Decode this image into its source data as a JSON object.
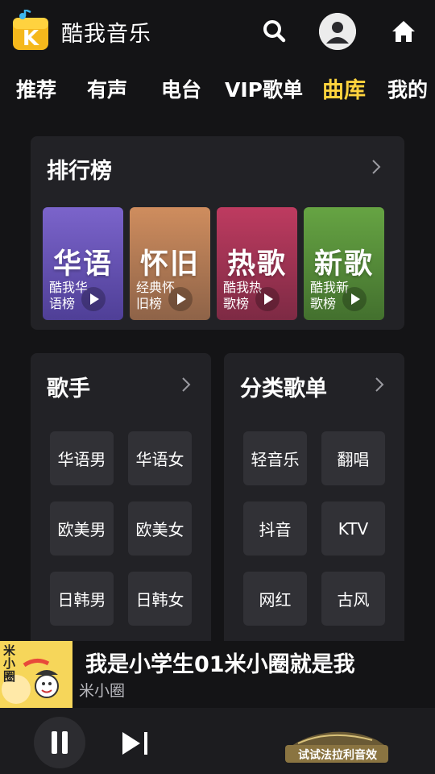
{
  "app": {
    "title": "酷我音乐"
  },
  "nav": {
    "tabs": [
      {
        "label": "推荐"
      },
      {
        "label": "有声"
      },
      {
        "label": "电台"
      },
      {
        "label": "VIP歌单"
      },
      {
        "label": "曲库",
        "active": true
      },
      {
        "label": "我的"
      }
    ]
  },
  "rankings": {
    "title": "排行榜",
    "tiles": [
      {
        "big": "华语",
        "sub": "酷我华语榜",
        "color_top": "#7a63c9",
        "color_bottom": "#5b4aa6"
      },
      {
        "big": "怀旧",
        "sub": "经典怀旧榜",
        "color_top": "#c6875a",
        "color_bottom": "#9e6c4b"
      },
      {
        "big": "热歌",
        "sub": "酷我热歌榜",
        "color_top": "#b3385a",
        "color_bottom": "#8d2f4c"
      },
      {
        "big": "新歌",
        "sub": "酷我新歌榜",
        "color_top": "#5f9a3f",
        "color_bottom": "#4a7a33"
      }
    ]
  },
  "singers": {
    "title": "歌手",
    "chips": [
      "华语男",
      "华语女",
      "欧美男",
      "欧美女",
      "日韩男",
      "日韩女"
    ]
  },
  "playlists": {
    "title": "分类歌单",
    "chips": [
      "轻音乐",
      "翻唱",
      "抖音",
      "KTV",
      "网红",
      "古风"
    ]
  },
  "now_playing": {
    "title": "我是小学生01米小圈就是我",
    "artist": "米小圈",
    "cover_text": "米小圈"
  },
  "promo": {
    "label": "试试法拉利音效"
  },
  "colors": {
    "accent": "#ffd33d",
    "background": "#141416",
    "card": "#222226",
    "chip": "#313136"
  }
}
